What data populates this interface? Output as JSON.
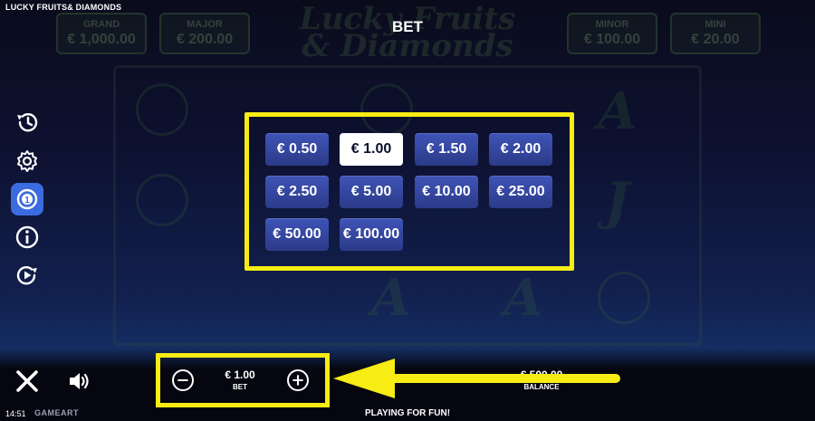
{
  "header": {
    "game_title": "LUCKY FRUITS& DIAMONDS",
    "screen_title": "BET"
  },
  "background": {
    "logo_line1": "Lucky Fruits",
    "logo_line2": "& Diamonds",
    "jackpots": [
      {
        "name": "GRAND",
        "value": "€ 1,000.00"
      },
      {
        "name": "MAJOR",
        "value": "€ 200.00"
      },
      {
        "name": "MINOR",
        "value": "€ 100.00"
      },
      {
        "name": "MINI",
        "value": "€ 20.00"
      }
    ]
  },
  "sidebar": {
    "items": [
      {
        "name": "history",
        "icon": "history-icon"
      },
      {
        "name": "settings",
        "icon": "gear-icon"
      },
      {
        "name": "bet",
        "icon": "coin-bet-icon",
        "active": true
      },
      {
        "name": "info",
        "icon": "info-icon"
      },
      {
        "name": "autoplay",
        "icon": "autoplay-icon"
      }
    ]
  },
  "bet_options": {
    "items": [
      "€ 0.50",
      "€ 1.00",
      "€ 1.50",
      "€ 2.00",
      "€ 2.50",
      "€ 5.00",
      "€ 10.00",
      "€ 25.00",
      "€ 50.00",
      "€ 100.00"
    ],
    "selected": "€ 1.00"
  },
  "bottom_bar": {
    "bet_value": "€ 1.00",
    "bet_label": "BET",
    "balance_value": "€ 500.00",
    "balance_label": "BALANCE",
    "clock": "14:51",
    "brand": "GAMEART",
    "status_text": "PLAYING FOR FUN!"
  },
  "colors": {
    "highlight": "#f7ec14",
    "bet_button": "#3344a0",
    "selected_button": "#ffffff",
    "active_sidebar": "#3b6be0"
  }
}
